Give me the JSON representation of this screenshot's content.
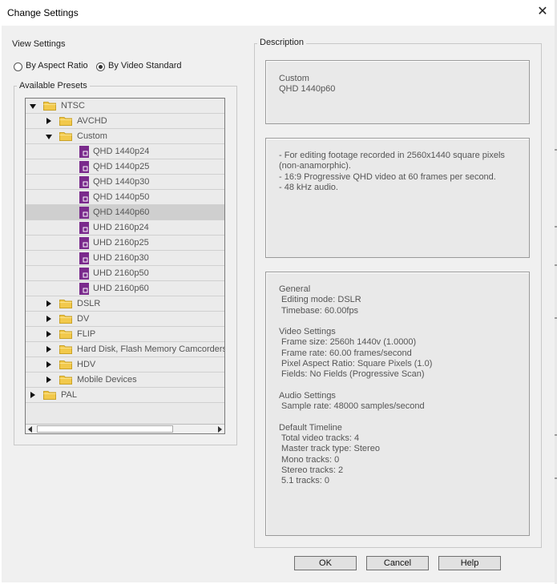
{
  "window": {
    "title": "Change Settings",
    "close_glyph": "✕"
  },
  "view_settings": {
    "label": "View Settings",
    "options": [
      {
        "label": "By Aspect Ratio",
        "selected": false
      },
      {
        "label": "By Video Standard",
        "selected": true
      }
    ]
  },
  "presets": {
    "label": "Available Presets",
    "tree": [
      {
        "label": "NTSC",
        "kind": "folder",
        "level": 0,
        "expanded": true
      },
      {
        "label": "AVCHD",
        "kind": "folder",
        "level": 1,
        "expanded": false
      },
      {
        "label": "Custom",
        "kind": "folder",
        "level": 1,
        "expanded": true
      },
      {
        "label": "QHD 1440p24",
        "kind": "file",
        "level": 2
      },
      {
        "label": "QHD 1440p25",
        "kind": "file",
        "level": 2
      },
      {
        "label": "QHD 1440p30",
        "kind": "file",
        "level": 2
      },
      {
        "label": "QHD 1440p50",
        "kind": "file",
        "level": 2
      },
      {
        "label": "QHD 1440p60",
        "kind": "file",
        "level": 2,
        "selected": true
      },
      {
        "label": "UHD 2160p24",
        "kind": "file",
        "level": 2
      },
      {
        "label": "UHD 2160p25",
        "kind": "file",
        "level": 2
      },
      {
        "label": "UHD 2160p30",
        "kind": "file",
        "level": 2
      },
      {
        "label": "UHD 2160p50",
        "kind": "file",
        "level": 2
      },
      {
        "label": "UHD 2160p60",
        "kind": "file",
        "level": 2
      },
      {
        "label": "DSLR",
        "kind": "folder",
        "level": 1,
        "expanded": false
      },
      {
        "label": "DV",
        "kind": "folder",
        "level": 1,
        "expanded": false
      },
      {
        "label": "FLIP",
        "kind": "folder",
        "level": 1,
        "expanded": false
      },
      {
        "label": "Hard Disk, Flash Memory Camcorders",
        "kind": "folder",
        "level": 1,
        "expanded": false
      },
      {
        "label": "HDV",
        "kind": "folder",
        "level": 1,
        "expanded": false
      },
      {
        "label": "Mobile Devices",
        "kind": "folder",
        "level": 1,
        "expanded": false
      },
      {
        "label": "PAL",
        "kind": "folder",
        "level": 0,
        "expanded": false
      }
    ]
  },
  "description": {
    "label": "Description",
    "name_lines": [
      "Custom",
      "QHD 1440p60"
    ],
    "summary_lines": [
      "- For editing footage recorded in 2560x1440 square pixels",
      "(non-anamorphic).",
      "- 16:9 Progressive QHD video at 60 frames per second.",
      "- 48 kHz audio."
    ],
    "details_lines": [
      "General",
      " Editing mode: DSLR",
      " Timebase: 60.00fps",
      "",
      "Video Settings",
      " Frame size: 2560h 1440v (1.0000)",
      " Frame rate: 60.00 frames/second",
      " Pixel Aspect Ratio: Square Pixels (1.0)",
      " Fields: No Fields (Progressive Scan)",
      "",
      "Audio Settings",
      " Sample rate: 48000 samples/second",
      "",
      "Default Timeline",
      " Total video tracks: 4",
      " Master track type: Stereo",
      " Mono tracks: 0",
      " Stereo tracks: 2",
      " 5.1 tracks: 0"
    ]
  },
  "buttons": {
    "ok": "OK",
    "cancel": "Cancel",
    "help": "Help"
  },
  "colors": {
    "file_icon": "#7a2a8c",
    "folder_icon": "#f2c94c",
    "selected_row": "#cfcfcf"
  }
}
